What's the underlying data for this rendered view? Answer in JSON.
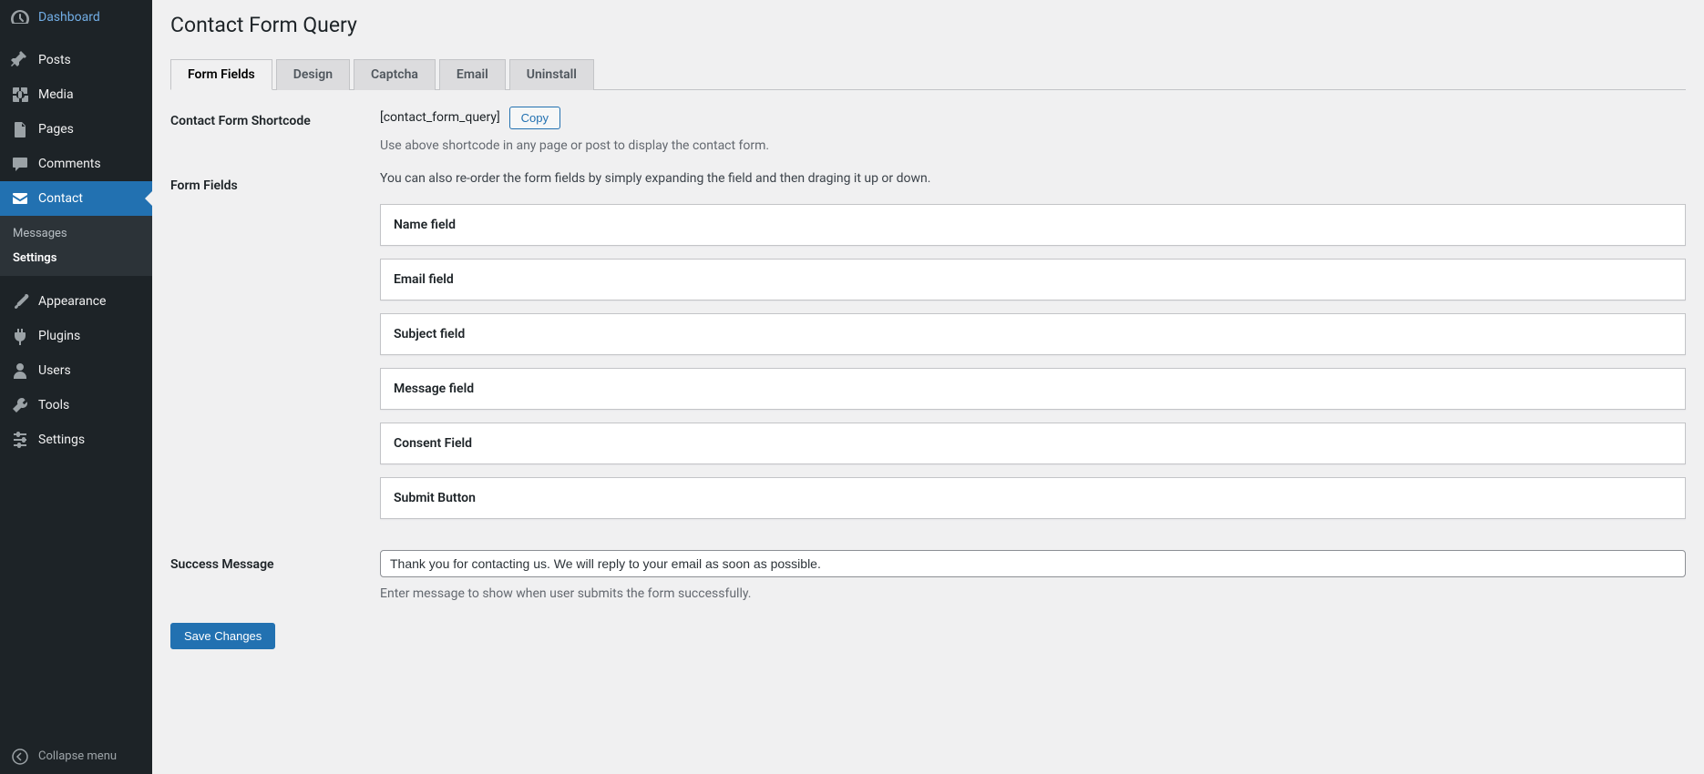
{
  "sidebar": {
    "items": [
      {
        "id": "dashboard",
        "label": "Dashboard",
        "icon": "dashboard-icon"
      },
      {
        "id": "posts",
        "label": "Posts",
        "icon": "pin-icon"
      },
      {
        "id": "media",
        "label": "Media",
        "icon": "media-icon"
      },
      {
        "id": "pages",
        "label": "Pages",
        "icon": "pages-icon"
      },
      {
        "id": "comments",
        "label": "Comments",
        "icon": "chat-icon"
      },
      {
        "id": "contact",
        "label": "Contact",
        "icon": "mail-icon",
        "current": true
      },
      {
        "id": "appearance",
        "label": "Appearance",
        "icon": "brush-icon"
      },
      {
        "id": "plugins",
        "label": "Plugins",
        "icon": "plug-icon"
      },
      {
        "id": "users",
        "label": "Users",
        "icon": "user-icon"
      },
      {
        "id": "tools",
        "label": "Tools",
        "icon": "wrench-icon"
      },
      {
        "id": "settings",
        "label": "Settings",
        "icon": "sliders-icon"
      }
    ],
    "submenu": [
      {
        "label": "Messages",
        "current": false
      },
      {
        "label": "Settings",
        "current": true
      }
    ],
    "collapse_label": "Collapse menu"
  },
  "page": {
    "title": "Contact Form Query",
    "tabs": [
      {
        "label": "Form Fields",
        "active": true
      },
      {
        "label": "Design"
      },
      {
        "label": "Captcha"
      },
      {
        "label": "Email"
      },
      {
        "label": "Uninstall"
      }
    ],
    "shortcode": {
      "label": "Contact Form Shortcode",
      "value": "[contact_form_query]",
      "copy_button": "Copy",
      "help": "Use above shortcode in any page or post to display the contact form."
    },
    "form_fields": {
      "label": "Form Fields",
      "help": "You can also re-order the form fields by simply expanding the field and then draging it up or down.",
      "items": [
        "Name field",
        "Email field",
        "Subject field",
        "Message field",
        "Consent Field",
        "Submit Button"
      ]
    },
    "success_message": {
      "label": "Success Message",
      "value": "Thank you for contacting us. We will reply to your email as soon as possible.",
      "help": "Enter message to show when user submits the form successfully."
    },
    "save_button": "Save Changes"
  }
}
